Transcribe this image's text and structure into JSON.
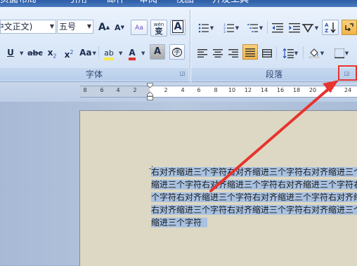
{
  "tabs": [
    "页面布局",
    "引用",
    "邮件",
    "审阅",
    "视图",
    "开发工具"
  ],
  "font_group": {
    "font_name": "(中文正文)",
    "font_size": "五号",
    "grow_label": "A",
    "shrink_label": "A",
    "clear_format_label": "Aa",
    "phonetic_label": "wén",
    "phonetic_char": "变",
    "border_label": "A",
    "underline_label": "U",
    "strike_label": "abc",
    "subscript_label": "x",
    "subscript_suffix": "2",
    "superscript_label": "x",
    "superscript_suffix": "2",
    "change_case_label": "Aa",
    "highlight_label": "ab",
    "font_color_label": "A",
    "shading_label": "A",
    "enclose_label": "字",
    "title": "字体"
  },
  "paragraph_group": {
    "title": "段落"
  },
  "ruler": {
    "numbers": [
      "8",
      "6",
      "4",
      "2",
      "2",
      "4",
      "6",
      "8",
      "10",
      "12",
      "14",
      "16",
      "18",
      "20",
      "22",
      "24"
    ]
  },
  "document": {
    "lines": [
      "右对齐缩进三个字符右对齐缩进三个字符右对齐缩进三个",
      "缩进三个字符右对齐缩进三个字符右对齐缩进三个字符右",
      "个字符右对齐缩进三个字符右对齐缩进三个字符右对齐缩",
      "右对齐缩进三个字符右对齐缩进三个字符右对齐缩进三个",
      "缩进三个字符"
    ]
  },
  "colors": {
    "annotation": "#e8332e",
    "selection": "#a9c2e2",
    "page": "#ddd8c3"
  }
}
